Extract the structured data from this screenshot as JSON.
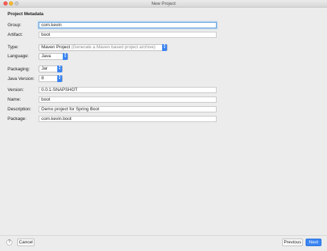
{
  "window": {
    "title": "New Project"
  },
  "section": {
    "title": "Project Metadata"
  },
  "form": {
    "group": {
      "label": "Group:",
      "value": "com.kevin"
    },
    "artifact": {
      "label": "Artifact:",
      "value": "boot"
    },
    "type": {
      "label": "Type:",
      "value": "Maven Project",
      "hint": "(Generate a Maven based project archive)"
    },
    "language": {
      "label": "Language:",
      "value": "Java"
    },
    "packaging": {
      "label": "Packaging:",
      "value": "Jar"
    },
    "java_version": {
      "label": "Java Version:",
      "value": "8"
    },
    "version": {
      "label": "Version:",
      "value": "0.0.1-SNAPSHOT"
    },
    "name": {
      "label": "Name:",
      "value": "boot"
    },
    "description": {
      "label": "Description:",
      "value": "Demo project for Spring Boot"
    },
    "package": {
      "label": "Package:",
      "value": "com.kevin.boot"
    }
  },
  "footer": {
    "help_label": "?",
    "cancel_label": "Cancel",
    "previous_label": "Previous",
    "next_label": "Next"
  },
  "colors": {
    "accent": "#3a84f2",
    "focus_ring": "#5b9dd9"
  },
  "icons": {
    "stepper": "chevron-up-down-icon",
    "help": "help-icon"
  }
}
